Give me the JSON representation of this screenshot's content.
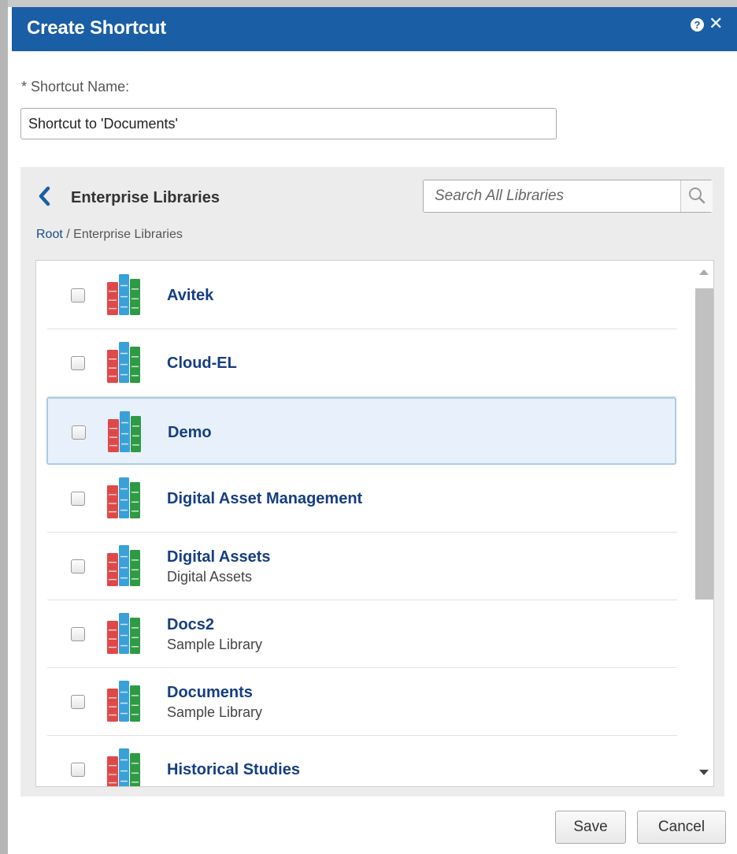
{
  "dialog": {
    "title": "Create Shortcut",
    "help_icon": "question-circle-icon",
    "help_glyph": "?",
    "close_icon": "close-icon",
    "close_glyph": "✕"
  },
  "shortcut": {
    "required_marker": "*",
    "label": "Shortcut Name:",
    "value": "Shortcut to 'Documents'"
  },
  "browser": {
    "title": "Enterprise Libraries",
    "back_icon": "chevron-left-icon",
    "search_placeholder": "Search All Libraries",
    "search_icon": "search-icon",
    "breadcrumb": {
      "root": "Root",
      "separator": " / ",
      "current": "Enterprise Libraries"
    },
    "library_icon": "library-books-icon",
    "items": [
      {
        "name": "Avitek",
        "description": "",
        "selected": false,
        "checked": false
      },
      {
        "name": "Cloud-EL",
        "description": "",
        "selected": false,
        "checked": false
      },
      {
        "name": "Demo",
        "description": "",
        "selected": true,
        "checked": false
      },
      {
        "name": "Digital Asset Management",
        "description": "",
        "selected": false,
        "checked": false
      },
      {
        "name": "Digital Assets",
        "description": "Digital Assets",
        "selected": false,
        "checked": false
      },
      {
        "name": "Docs2",
        "description": "Sample Library",
        "selected": false,
        "checked": false
      },
      {
        "name": "Documents",
        "description": "Sample Library",
        "selected": false,
        "checked": false
      },
      {
        "name": "Historical Studies",
        "description": "",
        "selected": false,
        "checked": false
      }
    ]
  },
  "buttons": {
    "save": "Save",
    "cancel": "Cancel"
  },
  "colors": {
    "header": "#1a5ea6",
    "link": "#163e82",
    "selected_row": "#e8f1fb",
    "book_red": "#e04848",
    "book_blue": "#3aa0d8",
    "book_green": "#2e9a44"
  }
}
